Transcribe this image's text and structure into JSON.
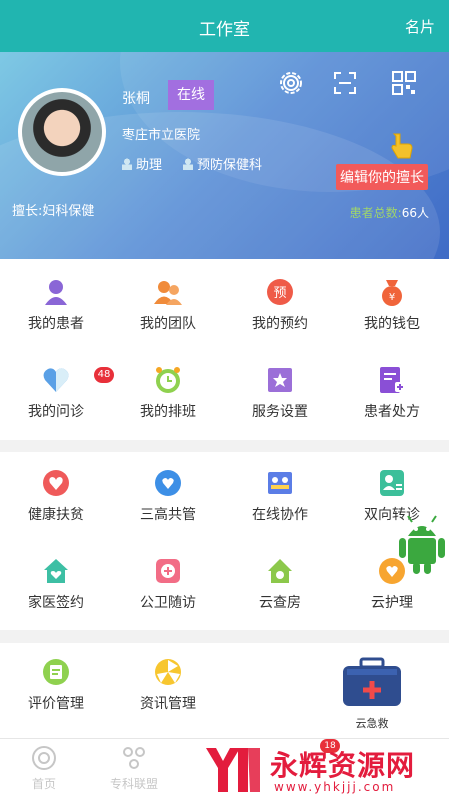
{
  "header": {
    "title": "工作室",
    "card_label": "名片"
  },
  "profile": {
    "name": "张桐",
    "status": "在线",
    "hospital": "枣庄市立医院",
    "tags": [
      "助理",
      "预防保健科"
    ],
    "specialty": "擅长:妇科保健",
    "edit_label": "编辑你的擅长",
    "patients_label": "患者总数:",
    "patients_count": "66人"
  },
  "grid1": [
    {
      "label": "我的患者",
      "icon": "patient-icon"
    },
    {
      "label": "我的团队",
      "icon": "team-icon"
    },
    {
      "label": "我的预约",
      "icon": "appointment-icon",
      "glyph": "预"
    },
    {
      "label": "我的钱包",
      "icon": "wallet-icon"
    },
    {
      "label": "我的问诊",
      "icon": "consult-icon",
      "badge": "48"
    },
    {
      "label": "我的排班",
      "icon": "schedule-icon"
    },
    {
      "label": "服务设置",
      "icon": "service-settings-icon"
    },
    {
      "label": "患者处方",
      "icon": "prescription-icon"
    }
  ],
  "grid2": [
    {
      "label": "健康扶贫",
      "icon": "poverty-relief-icon"
    },
    {
      "label": "三高共管",
      "icon": "three-highs-icon"
    },
    {
      "label": "在线协作",
      "icon": "online-collab-icon"
    },
    {
      "label": "双向转诊",
      "icon": "referral-icon"
    },
    {
      "label": "家医签约",
      "icon": "family-doctor-icon"
    },
    {
      "label": "公卫随访",
      "icon": "public-health-icon"
    },
    {
      "label": "云查房",
      "icon": "cloud-rounds-icon"
    },
    {
      "label": "云护理",
      "icon": "cloud-nursing-icon"
    }
  ],
  "grid3": [
    {
      "label": "评价管理",
      "icon": "evaluation-icon"
    },
    {
      "label": "资讯管理",
      "icon": "news-icon"
    }
  ],
  "emergency": {
    "label": "云急救"
  },
  "tabbar": {
    "items": [
      {
        "label": "首页"
      },
      {
        "label": "专科联盟"
      }
    ],
    "badge": "18"
  },
  "watermark": {
    "brand": "永辉资源网",
    "url": "www.yhkjjj.com"
  },
  "colors": {
    "header": "#21b5b0",
    "badge": "#e8303a",
    "edit": "#f25a5a",
    "status": "#a26fe0"
  }
}
